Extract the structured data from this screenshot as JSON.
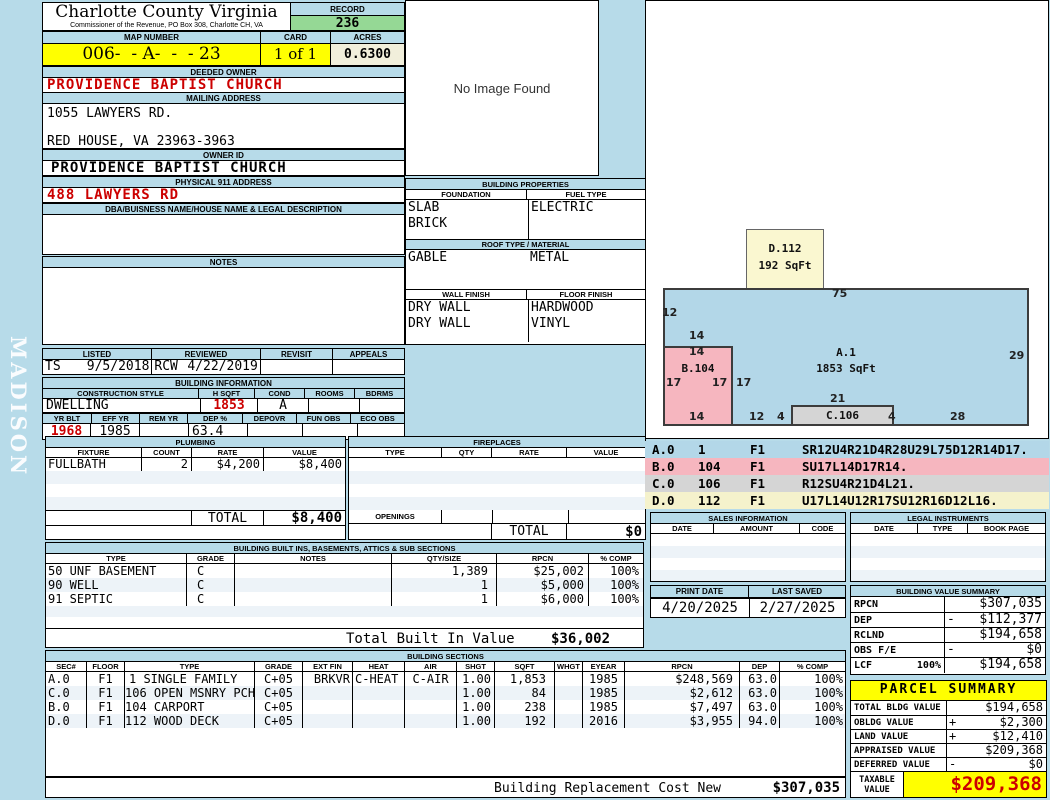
{
  "colors": {
    "page_bg": "#b7dbe9",
    "record_green": "#95d895",
    "highlight_yellow": "#ffff00",
    "acres_cream": "#f1efdb",
    "value_red": "#cc0000",
    "sketch_blue": "#b3d7e8",
    "sketch_pink": "#f6b6bf",
    "sketch_gray": "#d5d5d5",
    "sketch_yellow": "#faf7d0",
    "vector_yellow": "#f5f2cc"
  },
  "sidebar": {
    "vertical_text": "MADISON"
  },
  "header": {
    "county": "Charlotte County Virginia",
    "commissioner": "Commissioner of the Revenue, PO Box 308, Charlotte CH, VA",
    "record_label": "RECORD",
    "record_value": "236",
    "map_number_label": "MAP NUMBER",
    "map_number": "006-  - A-  -  - 23",
    "card_label": "CARD",
    "card_value": "1 of 1",
    "acres_label": "ACRES",
    "acres_value": "0.6300"
  },
  "owner": {
    "deeded_owner_label": "DEEDED OWNER",
    "deeded_owner": "PROVIDENCE BAPTIST CHURCH",
    "mailing_address_label": "MAILING ADDRESS",
    "mailing_line1": "1055 LAWYERS RD.",
    "mailing_line2": "RED HOUSE, VA 23963-3963",
    "owner_id_label": "OWNER ID",
    "owner_id": "PROVIDENCE BAPTIST CHURCH",
    "physical_label": "PHYSICAL 911 ADDRESS",
    "physical_address": "488 LAWYERS RD",
    "dba_label": "DBA/BUISNESS NAME/HOUSE NAME & LEGAL DESCRIPTION",
    "notes_label": "NOTES"
  },
  "photo": {
    "placeholder": "No Image Found"
  },
  "building_properties": {
    "title": "BUILDING PROPERTIES",
    "foundation_label": "FOUNDATION",
    "fuel_label": "FUEL TYPE",
    "foundation1": "SLAB",
    "foundation2": "BRICK",
    "fuel1": "ELECTRIC",
    "roof_label": "ROOF TYPE / MATERIAL",
    "roof_type": "GABLE",
    "roof_material": "METAL",
    "wall_label": "WALL FINISH",
    "floor_label": "FLOOR FINISH",
    "wall1": "DRY WALL",
    "wall2": "DRY WALL",
    "floor1": "HARDWOOD",
    "floor2": "VINYL"
  },
  "visits": {
    "listed_label": "LISTED",
    "listed_by": "TS",
    "listed_date": "9/5/2018",
    "reviewed_label": "REVIEWED",
    "reviewed_by": "RCW",
    "reviewed_date": "4/22/2019",
    "revisit_label": "REVISIT",
    "revisit": "",
    "appeals_label": "APPEALS",
    "appeals": ""
  },
  "building_information": {
    "title": "BUILDING INFORMATION",
    "style_label": "CONSTRUCTION STYLE",
    "style": "DWELLING",
    "hsqft_label": "H SQFT",
    "hsqft": "1853",
    "cond_label": "COND",
    "cond": "A",
    "rooms_label": "ROOMS",
    "rooms": "",
    "bdrms_label": "BDRMS",
    "bdrms": "",
    "yrblt_label": "YR BLT",
    "yrblt": "1968",
    "effyr_label": "EFF YR",
    "effyr": "1985",
    "remyr_label": "REM YR",
    "remyr": "",
    "dep_label": "DEP %",
    "dep": "63.4",
    "depovr_label": "DEPOVR",
    "depovr": "",
    "funobs_label": "FUN OBS",
    "funobs": "",
    "ecoobs_label": "ECO OBS",
    "ecoobs": ""
  },
  "plumbing": {
    "title": "PLUMBING",
    "headers": [
      "FIXTURE",
      "COUNT",
      "RATE",
      "VALUE"
    ],
    "rows": [
      [
        "FULLBATH",
        "2",
        "$4,200",
        "$8,400"
      ]
    ],
    "total_label": "TOTAL",
    "total": "$8,400"
  },
  "fireplaces": {
    "title": "FIREPLACES",
    "headers": [
      "TYPE",
      "QTY",
      "RATE",
      "VALUE"
    ],
    "openings_label": "OPENINGS",
    "total_label": "TOTAL",
    "total": "$0"
  },
  "built_ins": {
    "title": "BUILDING BUILT INS, BASEMENTS, ATTICS & SUB SECTIONS",
    "headers": [
      "TYPE",
      "GRADE",
      "NOTES",
      "QTY/SIZE",
      "RPCN",
      "% COMP"
    ],
    "rows": [
      [
        "50 UNF BASEMENT",
        "C",
        "",
        "1,389",
        "$25,002",
        "100%"
      ],
      [
        "90 WELL",
        "C",
        "",
        "1",
        "$5,000",
        "100%"
      ],
      [
        "91 SEPTIC",
        "C",
        "",
        "1",
        "$6,000",
        "100%"
      ]
    ],
    "total_label": "Total Built In Value",
    "total": "$36,002"
  },
  "building_sections": {
    "title": "BUILDING SECTIONS",
    "headers": [
      "SEC#",
      "FLOOR",
      "TYPE",
      "GRADE",
      "EXT FIN",
      "HEAT",
      "AIR",
      "SHGT",
      "SQFT",
      "WHGT",
      "EYEAR",
      "RPCN",
      "DEP",
      "% COMP"
    ],
    "rows": [
      [
        "A.0",
        "F1",
        "1 SINGLE FAMILY",
        "C+05",
        "BRKVR",
        "C-HEAT",
        "C-AIR",
        "1.00",
        "1,853",
        "",
        "1985",
        "$248,569",
        "63.0",
        "100%"
      ],
      [
        "C.0",
        "F1",
        "106 OPEN MSNRY PCH",
        "C+05",
        "",
        "",
        "",
        "1.00",
        "84",
        "",
        "1985",
        "$2,612",
        "63.0",
        "100%"
      ],
      [
        "B.0",
        "F1",
        "104 CARPORT",
        "C+05",
        "",
        "",
        "",
        "1.00",
        "238",
        "",
        "1985",
        "$7,497",
        "63.0",
        "100%"
      ],
      [
        "D.0",
        "F1",
        "112 WOOD DECK",
        "C+05",
        "",
        "",
        "",
        "1.00",
        "192",
        "",
        "2016",
        "$3,955",
        "94.0",
        "100%"
      ]
    ]
  },
  "sketch": {
    "a_label": "A.1",
    "a_sqft": "1853 SqFt",
    "b_label": "B.104",
    "c_label": "C.106",
    "d_label": "D.112",
    "d_sqft": "192 SqFt",
    "dims": [
      {
        "t": "75"
      },
      {
        "t": "12"
      },
      {
        "t": "14"
      },
      {
        "t": "14"
      },
      {
        "t": "17"
      },
      {
        "t": "17"
      },
      {
        "t": "17"
      },
      {
        "t": "29"
      },
      {
        "t": "21"
      },
      {
        "t": "14"
      },
      {
        "t": "12"
      },
      {
        "t": "4"
      },
      {
        "t": "4"
      },
      {
        "t": "28"
      }
    ],
    "vectors": [
      {
        "sec": "A.0",
        "code": "1",
        "floor": "F1",
        "path": "SR12U4R21D4R28U29L75D12R14D17."
      },
      {
        "sec": "B.0",
        "code": "104",
        "floor": "F1",
        "path": "SU17L14D17R14."
      },
      {
        "sec": "C.0",
        "code": "106",
        "floor": "F1",
        "path": "R12SU4R21D4L21."
      },
      {
        "sec": "D.0",
        "code": "112",
        "floor": "F1",
        "path": "U17L14U12R17SU12R16D12L16."
      }
    ]
  },
  "sales": {
    "title": "SALES INFORMATION",
    "headers": [
      "DATE",
      "AMOUNT",
      "CODE"
    ]
  },
  "legal": {
    "title": "LEGAL INSTRUMENTS",
    "headers": [
      "DATE",
      "TYPE",
      "BOOK PAGE"
    ]
  },
  "print_info": {
    "print_label": "PRINT DATE",
    "print_date": "4/20/2025",
    "saved_label": "LAST SAVED",
    "saved_date": "2/27/2025"
  },
  "building_value_summary": {
    "title": "BUILDING VALUE SUMMARY",
    "rows": [
      {
        "label": "RPCN",
        "extra": "",
        "sign": "",
        "value": "$307,035"
      },
      {
        "label": "DEP",
        "extra": "",
        "sign": "-",
        "value": "$112,377"
      },
      {
        "label": "RCLND",
        "extra": "",
        "sign": "",
        "value": "$194,658"
      },
      {
        "label": "OBS F/E",
        "extra": "",
        "sign": "-",
        "value": "$0"
      },
      {
        "label": "LCF",
        "extra": "100%",
        "sign": "",
        "value": "$194,658"
      }
    ]
  },
  "parcel_summary": {
    "title": "PARCEL SUMMARY",
    "rows": [
      {
        "label": "TOTAL BLDG VALUE",
        "sign": "",
        "value": "$194,658"
      },
      {
        "label": "OBLDG VALUE",
        "sign": "+",
        "value": "$2,300"
      },
      {
        "label": "LAND VALUE",
        "sign": "+",
        "value": "$12,410"
      },
      {
        "label": "APPRAISED VALUE",
        "sign": "",
        "value": "$209,368"
      },
      {
        "label": "DEFERRED VALUE",
        "sign": "-",
        "value": "$0"
      }
    ],
    "taxable_label1": "TAXABLE",
    "taxable_label2": "VALUE",
    "taxable_value": "$209,368"
  },
  "footer": {
    "label": "Building Replacement Cost New",
    "value": "$307,035"
  }
}
